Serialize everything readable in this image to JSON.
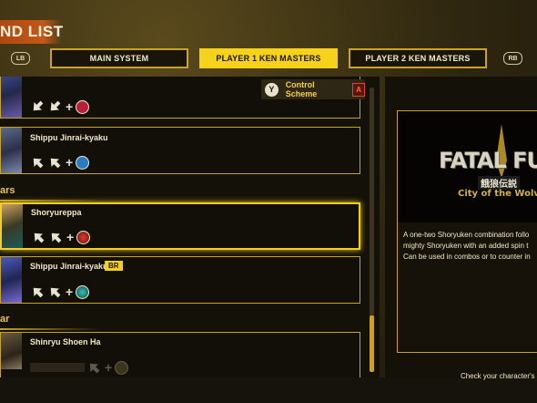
{
  "header": {
    "title": "ND LIST",
    "lb_label": "LB",
    "rb_label": "RB",
    "tabs": [
      {
        "label": "MAIN SYSTEM",
        "active": false
      },
      {
        "label": "PLAYER 1 KEN MASTERS",
        "active": true
      },
      {
        "label": "PLAYER 2 KEN MASTERS",
        "active": false
      }
    ]
  },
  "control_scheme": {
    "button_icon": "Y",
    "label": "Control Scheme",
    "mode_icon": "A"
  },
  "sections": {
    "section_1": "ars",
    "section_2": "ar"
  },
  "moves": [
    {
      "name": "",
      "final_button_icon": "punch-icon"
    },
    {
      "name": "Shippu Jinrai-kyaku",
      "final_button_icon": "kick-icon"
    },
    {
      "name": "Shoryureppa",
      "final_button_icon": "burst-icon",
      "selected": true
    },
    {
      "name": "Shippu Jinrai-kyaku",
      "tag": "BR",
      "final_button_icon": "burst-teal-icon"
    },
    {
      "name": "Shinryu Shoen Ha",
      "final_button_icon": "partial-icon"
    }
  ],
  "right_panel": {
    "logo_title": "FATAL FUR",
    "logo_kanji": "餓狼伝説",
    "logo_subtitle": "City of the Wolves",
    "description_lines": [
      "A one-two Shoryuken combination follo",
      "mighty Shoryuken with an added spin t",
      "Can be used in combos or to counter in"
    ]
  },
  "footer": {
    "hint": "Check your character's"
  },
  "colors": {
    "accent_gold": "#c9a227",
    "active_tab": "#f7d21a",
    "title_band": "#c4581a"
  }
}
